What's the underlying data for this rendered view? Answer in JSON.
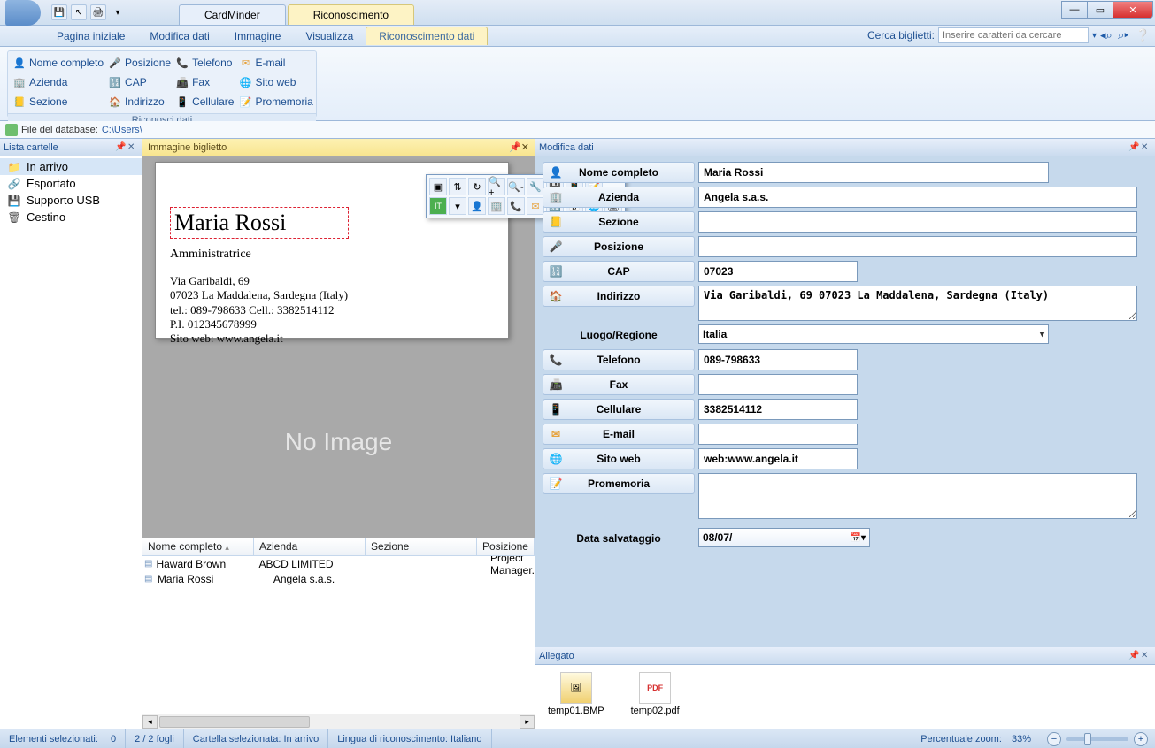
{
  "title": {
    "app": "CardMinder",
    "context_tab": "Riconoscimento"
  },
  "menubar": {
    "items": [
      "Pagina iniziale",
      "Modifica dati",
      "Immagine",
      "Visualizza",
      "Riconoscimento dati"
    ],
    "active_index": 4
  },
  "search": {
    "label": "Cerca biglietti:",
    "placeholder": "Inserire caratteri da cercare"
  },
  "ribbon": {
    "group_title": "Riconosci dati",
    "items": [
      "Nome completo",
      "Posizione",
      "Telefono",
      "E-mail",
      "Azienda",
      "CAP",
      "Fax",
      "Sito web",
      "Sezione",
      "Indirizzo",
      "Cellulare",
      "Promemoria"
    ]
  },
  "dbpath": {
    "label": "File del database:",
    "path": "C:\\Users\\"
  },
  "folders": {
    "title": "Lista cartelle",
    "items": [
      "In arrivo",
      "Esportato",
      "Supporto USB",
      "Cestino"
    ]
  },
  "card_panel": {
    "title": "Immagine biglietto",
    "no_image": "No Image"
  },
  "card": {
    "name": "Maria Rossi",
    "role": "Amministratrice",
    "line1": "Via Garibaldi, 69",
    "line2": "07023 La Maddalena, Sardegna (Italy)",
    "line3": "tel.: 089-798633    Cell.: 3382514112",
    "line4": "P.I. 012345678999",
    "line5": "Sito web: www.angela.it"
  },
  "table": {
    "headers": [
      "Nome completo",
      "Azienda",
      "Sezione",
      "Posizione"
    ],
    "rows": [
      {
        "name": "Haward Brown",
        "azienda": "ABCD LIMITED",
        "sezione": "",
        "posizione": "Project Manager."
      },
      {
        "name": "Maria Rossi",
        "azienda": "Angela s.a.s.",
        "sezione": "",
        "posizione": ""
      }
    ]
  },
  "edit_panel": {
    "title": "Modifica dati"
  },
  "fields": {
    "nome_label": "Nome completo",
    "nome": "Maria Rossi",
    "azienda_label": "Azienda",
    "azienda": "Angela s.a.s.",
    "sezione_label": "Sezione",
    "sezione": "",
    "posizione_label": "Posizione",
    "posizione": "",
    "cap_label": "CAP",
    "cap": "07023",
    "indirizzo_label": "Indirizzo",
    "indirizzo": "Via Garibaldi, 69 07023 La Maddalena, Sardegna (Italy)",
    "luogo_label": "Luogo/Regione",
    "luogo": "Italia",
    "telefono_label": "Telefono",
    "telefono": "089-798633",
    "fax_label": "Fax",
    "fax": "",
    "cellulare_label": "Cellulare",
    "cellulare": "3382514112",
    "email_label": "E-mail",
    "email": "",
    "sito_label": "Sito web",
    "sito": "web:www.angela.it",
    "memo_label": "Promemoria",
    "memo": "",
    "data_label": "Data salvataggio",
    "data": "08/07/"
  },
  "allegato": {
    "title": "Allegato",
    "files": [
      "temp01.BMP",
      "temp02.pdf"
    ]
  },
  "status": {
    "sel_label": "Elementi selezionati:",
    "sel_count": "0",
    "fogli": "2 / 2 fogli",
    "cartella": "Cartella selezionata: In arrivo",
    "lingua": "Lingua di riconoscimento: Italiano",
    "zoom_label": "Percentuale zoom:",
    "zoom_pct": "33%"
  }
}
